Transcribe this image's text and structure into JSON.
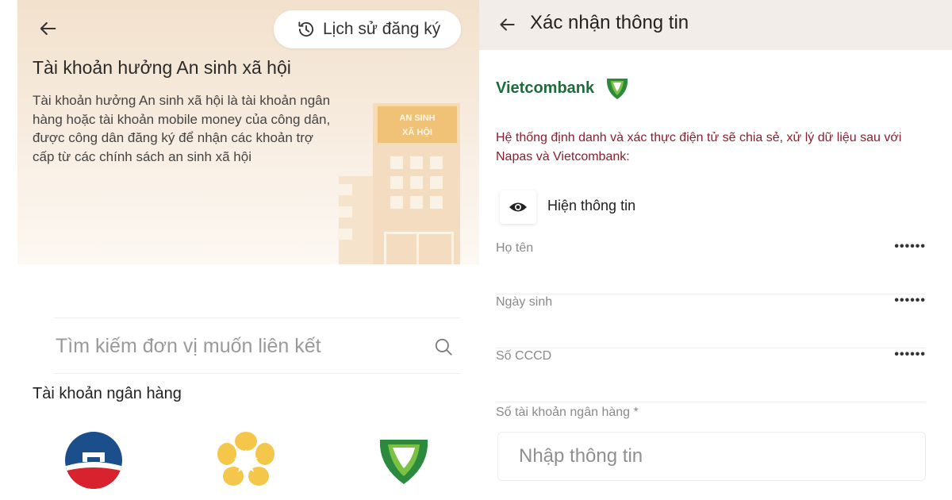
{
  "left": {
    "history_button": "Lịch sử đăng ký",
    "title": "Tài khoản hưởng An sinh xã hội",
    "description": "Tài khoản hưởng An sinh xã hội là tài khoản ngân hàng hoặc tài khoản mobile money của công dân, được công dân đăng ký để nhận các khoản trợ cấp từ các chính sách an sinh xã hội",
    "building_sign_line1": "AN SINH",
    "building_sign_line2": "XÃ HỘI",
    "search_placeholder": "Tìm kiếm đơn vị muốn liên kết",
    "section_title": "Tài khoản ngân hàng",
    "banks": [
      "vietinbank-logo",
      "sacombank-logo",
      "vietcombank-logo"
    ]
  },
  "right": {
    "title": "Xác nhận thông tin",
    "partner_name": "Vietcombank",
    "notice": "Hệ thống định danh và xác thực điện tử sẽ chia sẻ, xử lý dữ liệu sau với Napas và Vietcombank:",
    "show_info_label": "Hiện thông tin",
    "fields": [
      {
        "label": "Họ tên",
        "value": "••••••"
      },
      {
        "label": "Ngày sinh",
        "value": "••••••"
      },
      {
        "label": "Số CCCD",
        "value": "••••••"
      }
    ],
    "account_label": "Số tài khoản ngân hàng *",
    "account_placeholder": "Nhập thông tin"
  },
  "colors": {
    "notice_red": "#8b1e2e",
    "vietcombank_green": "#1e6b3c",
    "header_bg": "#f3ede9",
    "hero_bg": "#f2e1cc"
  }
}
